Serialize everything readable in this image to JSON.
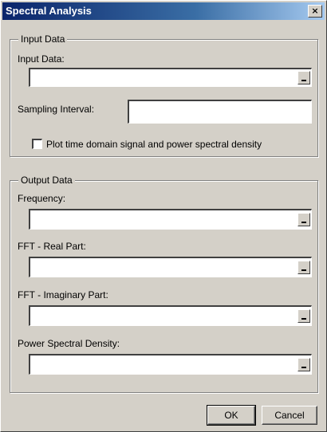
{
  "window": {
    "title": "Spectral Analysis",
    "close_glyph": "×"
  },
  "input_group": {
    "legend": "Input Data",
    "input_data_label": "Input Data:",
    "input_data_value": "",
    "sampling_label": "Sampling Interval:",
    "sampling_value": "",
    "plot_checkbox_label": "Plot time domain signal and power spectral density",
    "plot_checked": false
  },
  "output_group": {
    "legend": "Output Data",
    "fields": [
      {
        "label": "Frequency:",
        "value": ""
      },
      {
        "label": "FFT - Real Part:",
        "value": ""
      },
      {
        "label": "FFT - Imaginary Part:",
        "value": ""
      },
      {
        "label": "Power Spectral Density:",
        "value": ""
      }
    ]
  },
  "buttons": {
    "ok": "OK",
    "cancel": "Cancel"
  },
  "colors": {
    "title_start": "#0a246a",
    "title_end": "#a6caf0",
    "face": "#d4d0c8"
  }
}
